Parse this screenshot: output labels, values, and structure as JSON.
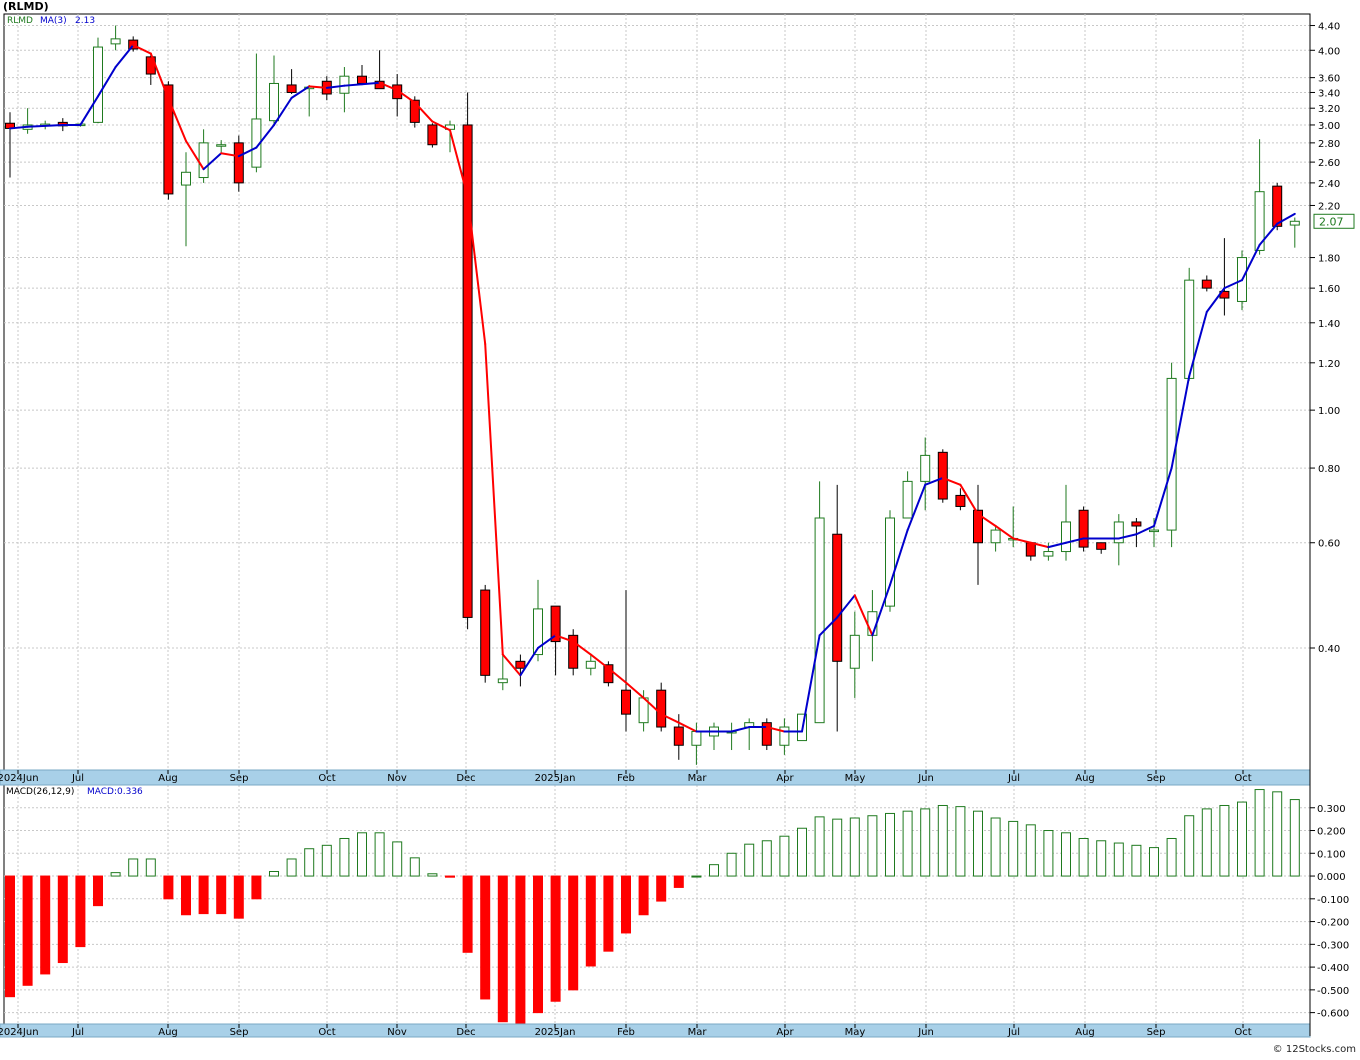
{
  "header": {
    "title": "(RLMD)"
  },
  "legend": {
    "symbol": "RLMD",
    "ma_label": "MA(3)",
    "ma_value": "2.13"
  },
  "macd_legend": {
    "label": "MACD(26,12,9)",
    "value": "MACD:0.336"
  },
  "credit": "© 12Stocks.com",
  "colors": {
    "up": "#1f7a1f",
    "down": "#ff0000",
    "ma_up": "#0000cc",
    "ma_down": "#ff0000",
    "axis_band": "#a8d0e8",
    "price_tag": "#1f7a1f"
  },
  "chart_data": [
    {
      "type": "candlestick",
      "title": "(RLMD)",
      "scale": "log",
      "ylim": [
        0.25,
        4.6
      ],
      "grid": true,
      "y_ticks": [
        "4.40",
        "4.00",
        "3.60",
        "3.40",
        "3.20",
        "3.00",
        "2.80",
        "2.60",
        "2.40",
        "2.20",
        "1.80",
        "1.60",
        "1.40",
        "1.20",
        "1.00",
        "0.80",
        "0.60",
        "0.40"
      ],
      "last_price": "2.07",
      "x_labels": [
        "2024Jun",
        "Jul",
        "Aug",
        "Sep",
        "Oct",
        "Nov",
        "Dec",
        "2025Jan",
        "Feb",
        "Mar",
        "Apr",
        "May",
        "Jun",
        "Jul",
        "Aug",
        "Sep",
        "Oct"
      ],
      "candles": [
        {
          "o": 3.02,
          "h": 3.15,
          "l": 2.45,
          "c": 2.96
        },
        {
          "o": 2.95,
          "h": 3.2,
          "l": 2.9,
          "c": 3.0
        },
        {
          "o": 2.99,
          "h": 3.05,
          "l": 2.95,
          "c": 3.01
        },
        {
          "o": 3.03,
          "h": 3.08,
          "l": 2.93,
          "c": 2.99
        },
        {
          "o": 3.0,
          "h": 3.02,
          "l": 2.98,
          "c": 3.01
        },
        {
          "o": 3.03,
          "h": 4.2,
          "l": 3.02,
          "c": 4.05
        },
        {
          "o": 4.1,
          "h": 4.4,
          "l": 4.0,
          "c": 4.18
        },
        {
          "o": 4.16,
          "h": 4.22,
          "l": 3.98,
          "c": 4.02
        },
        {
          "o": 3.9,
          "h": 3.95,
          "l": 3.5,
          "c": 3.65
        },
        {
          "o": 3.5,
          "h": 3.55,
          "l": 2.25,
          "c": 2.3
        },
        {
          "o": 2.38,
          "h": 2.7,
          "l": 1.88,
          "c": 2.5
        },
        {
          "o": 2.45,
          "h": 2.95,
          "l": 2.4,
          "c": 2.8
        },
        {
          "o": 2.77,
          "h": 2.83,
          "l": 2.7,
          "c": 2.78
        },
        {
          "o": 2.8,
          "h": 2.88,
          "l": 2.32,
          "c": 2.4
        },
        {
          "o": 2.55,
          "h": 3.95,
          "l": 2.5,
          "c": 3.07
        },
        {
          "o": 3.05,
          "h": 3.92,
          "l": 3.0,
          "c": 3.52
        },
        {
          "o": 3.5,
          "h": 3.72,
          "l": 3.38,
          "c": 3.4
        },
        {
          "o": 3.45,
          "h": 3.5,
          "l": 3.1,
          "c": 3.47
        },
        {
          "o": 3.55,
          "h": 3.62,
          "l": 3.3,
          "c": 3.38
        },
        {
          "o": 3.39,
          "h": 3.75,
          "l": 3.15,
          "c": 3.62
        },
        {
          "o": 3.62,
          "h": 3.78,
          "l": 3.5,
          "c": 3.52
        },
        {
          "o": 3.55,
          "h": 4.0,
          "l": 3.45,
          "c": 3.45
        },
        {
          "o": 3.5,
          "h": 3.65,
          "l": 3.1,
          "c": 3.32
        },
        {
          "o": 3.3,
          "h": 3.35,
          "l": 2.97,
          "c": 3.03
        },
        {
          "o": 3.0,
          "h": 3.02,
          "l": 2.75,
          "c": 2.78
        },
        {
          "o": 2.95,
          "h": 3.05,
          "l": 2.7,
          "c": 3.0
        },
        {
          "o": 3.0,
          "h": 3.4,
          "l": 0.43,
          "c": 0.45
        },
        {
          "o": 0.5,
          "h": 0.51,
          "l": 0.35,
          "c": 0.36
        },
        {
          "o": 0.35,
          "h": 0.39,
          "l": 0.34,
          "c": 0.355
        },
        {
          "o": 0.38,
          "h": 0.39,
          "l": 0.345,
          "c": 0.37
        },
        {
          "o": 0.39,
          "h": 0.52,
          "l": 0.38,
          "c": 0.465
        },
        {
          "o": 0.47,
          "h": 0.47,
          "l": 0.36,
          "c": 0.41
        },
        {
          "o": 0.42,
          "h": 0.43,
          "l": 0.36,
          "c": 0.37
        },
        {
          "o": 0.37,
          "h": 0.39,
          "l": 0.36,
          "c": 0.38
        },
        {
          "o": 0.375,
          "h": 0.38,
          "l": 0.345,
          "c": 0.35
        },
        {
          "o": 0.34,
          "h": 0.5,
          "l": 0.29,
          "c": 0.31
        },
        {
          "o": 0.3,
          "h": 0.34,
          "l": 0.29,
          "c": 0.33
        },
        {
          "o": 0.34,
          "h": 0.35,
          "l": 0.29,
          "c": 0.295
        },
        {
          "o": 0.295,
          "h": 0.31,
          "l": 0.26,
          "c": 0.275
        },
        {
          "o": 0.275,
          "h": 0.3,
          "l": 0.255,
          "c": 0.29
        },
        {
          "o": 0.285,
          "h": 0.3,
          "l": 0.27,
          "c": 0.295
        },
        {
          "o": 0.29,
          "h": 0.3,
          "l": 0.27,
          "c": 0.29
        },
        {
          "o": 0.295,
          "h": 0.305,
          "l": 0.27,
          "c": 0.3
        },
        {
          "o": 0.3,
          "h": 0.305,
          "l": 0.27,
          "c": 0.275
        },
        {
          "o": 0.275,
          "h": 0.305,
          "l": 0.265,
          "c": 0.295
        },
        {
          "o": 0.28,
          "h": 0.31,
          "l": 0.28,
          "c": 0.31
        },
        {
          "o": 0.3,
          "h": 0.76,
          "l": 0.3,
          "c": 0.66
        },
        {
          "o": 0.62,
          "h": 0.75,
          "l": 0.29,
          "c": 0.38
        },
        {
          "o": 0.37,
          "h": 0.46,
          "l": 0.33,
          "c": 0.42
        },
        {
          "o": 0.42,
          "h": 0.5,
          "l": 0.38,
          "c": 0.46
        },
        {
          "o": 0.47,
          "h": 0.68,
          "l": 0.46,
          "c": 0.66
        },
        {
          "o": 0.66,
          "h": 0.79,
          "l": 0.66,
          "c": 0.76
        },
        {
          "o": 0.76,
          "h": 0.9,
          "l": 0.68,
          "c": 0.84
        },
        {
          "o": 0.85,
          "h": 0.86,
          "l": 0.7,
          "c": 0.71
        },
        {
          "o": 0.72,
          "h": 0.74,
          "l": 0.68,
          "c": 0.69
        },
        {
          "o": 0.68,
          "h": 0.75,
          "l": 0.51,
          "c": 0.6
        },
        {
          "o": 0.6,
          "h": 0.64,
          "l": 0.58,
          "c": 0.63
        },
        {
          "o": 0.61,
          "h": 0.69,
          "l": 0.59,
          "c": 0.61
        },
        {
          "o": 0.6,
          "h": 0.6,
          "l": 0.56,
          "c": 0.57
        },
        {
          "o": 0.57,
          "h": 0.6,
          "l": 0.56,
          "c": 0.58
        },
        {
          "o": 0.58,
          "h": 0.75,
          "l": 0.56,
          "c": 0.65
        },
        {
          "o": 0.68,
          "h": 0.69,
          "l": 0.58,
          "c": 0.59
        },
        {
          "o": 0.6,
          "h": 0.6,
          "l": 0.575,
          "c": 0.585
        },
        {
          "o": 0.6,
          "h": 0.67,
          "l": 0.55,
          "c": 0.65
        },
        {
          "o": 0.65,
          "h": 0.66,
          "l": 0.59,
          "c": 0.64
        },
        {
          "o": 0.63,
          "h": 0.66,
          "l": 0.59,
          "c": 0.63
        },
        {
          "o": 0.63,
          "h": 1.2,
          "l": 0.59,
          "c": 1.13
        },
        {
          "o": 1.13,
          "h": 1.73,
          "l": 1.12,
          "c": 1.65
        },
        {
          "o": 1.65,
          "h": 1.68,
          "l": 1.58,
          "c": 1.6
        },
        {
          "o": 1.58,
          "h": 1.94,
          "l": 1.44,
          "c": 1.54
        },
        {
          "o": 1.52,
          "h": 1.85,
          "l": 1.47,
          "c": 1.8
        },
        {
          "o": 1.85,
          "h": 2.84,
          "l": 1.82,
          "c": 2.32
        },
        {
          "o": 2.37,
          "h": 2.4,
          "l": 2.0,
          "c": 2.03
        },
        {
          "o": 2.04,
          "h": 2.1,
          "l": 1.87,
          "c": 2.07
        }
      ],
      "ma3": [
        2.96,
        2.98,
        2.99,
        3.0,
        3.0,
        3.35,
        3.75,
        4.08,
        3.95,
        3.32,
        2.82,
        2.53,
        2.69,
        2.66,
        2.75,
        3.0,
        3.33,
        3.48,
        3.46,
        3.49,
        3.51,
        3.53,
        3.43,
        3.27,
        3.04,
        2.94,
        2.28,
        1.29,
        0.39,
        0.36,
        0.4,
        0.42,
        0.41,
        0.39,
        0.37,
        0.35,
        0.33,
        0.31,
        0.3,
        0.29,
        0.29,
        0.29,
        0.295,
        0.295,
        0.29,
        0.29,
        0.42,
        0.45,
        0.49,
        0.42,
        0.51,
        0.63,
        0.75,
        0.77,
        0.75,
        0.67,
        0.64,
        0.61,
        0.6,
        0.59,
        0.6,
        0.61,
        0.61,
        0.61,
        0.62,
        0.64,
        0.8,
        1.14,
        1.46,
        1.6,
        1.65,
        1.89,
        2.05,
        2.13
      ],
      "series": [
        {
          "name": "MA(3)",
          "value": "2.13"
        }
      ]
    },
    {
      "type": "bar",
      "title": "MACD(26,12,9)",
      "ylim": [
        -0.65,
        0.4
      ],
      "y_ticks": [
        "0.300",
        "0.200",
        "0.100",
        "0.000",
        "-0.100",
        "-0.200",
        "-0.300",
        "-0.400",
        "-0.500",
        "-0.600"
      ],
      "x_labels": [
        "2024Jun",
        "Jul",
        "Aug",
        "Sep",
        "Oct",
        "Nov",
        "Dec",
        "2025Jan",
        "Feb",
        "Mar",
        "Apr",
        "May",
        "Jun",
        "Jul",
        "Aug",
        "Sep",
        "Oct"
      ],
      "values": [
        -0.53,
        -0.48,
        -0.43,
        -0.38,
        -0.31,
        -0.13,
        0.015,
        0.075,
        0.075,
        -0.1,
        -0.17,
        -0.165,
        -0.165,
        -0.185,
        -0.1,
        0.02,
        0.075,
        0.12,
        0.135,
        0.165,
        0.19,
        0.19,
        0.15,
        0.08,
        0.01,
        -0.005,
        -0.335,
        -0.54,
        -0.64,
        -0.655,
        -0.6,
        -0.55,
        -0.5,
        -0.395,
        -0.33,
        -0.25,
        -0.17,
        -0.11,
        -0.05,
        0.0,
        0.05,
        0.1,
        0.14,
        0.155,
        0.175,
        0.21,
        0.26,
        0.25,
        0.255,
        0.265,
        0.275,
        0.285,
        0.295,
        0.31,
        0.305,
        0.285,
        0.255,
        0.24,
        0.225,
        0.2,
        0.19,
        0.165,
        0.155,
        0.145,
        0.135,
        0.125,
        0.165,
        0.265,
        0.295,
        0.31,
        0.325,
        0.38,
        0.37,
        0.336
      ],
      "series": [
        {
          "name": "MACD",
          "value": "0.336"
        }
      ]
    }
  ]
}
